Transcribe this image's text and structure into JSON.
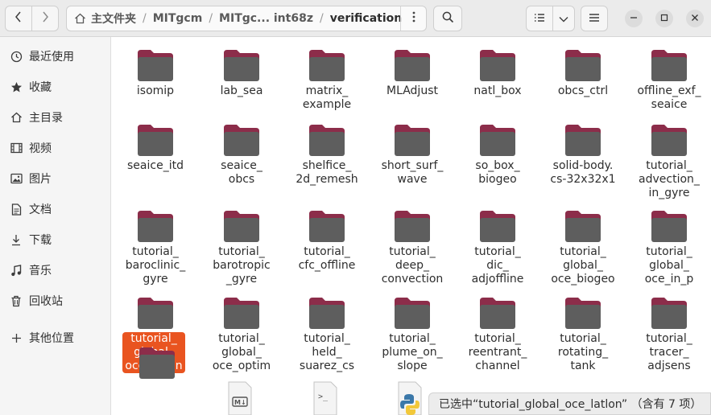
{
  "header": {
    "back_icon": "chevron-left-icon",
    "forward_icon": "chevron-right-icon",
    "breadcrumbs": [
      "主文件夹",
      "MITgcm",
      "MITgc... int68z",
      "verification"
    ],
    "search_icon": "search-icon",
    "view_icon": "list-view-icon",
    "menu_icon": "hamburger-menu-icon"
  },
  "sidebar": {
    "items": [
      {
        "label": "最近使用",
        "icon": "clock-icon"
      },
      {
        "label": "收藏",
        "icon": "star-icon"
      },
      {
        "label": "主目录",
        "icon": "home-icon"
      },
      {
        "label": "视频",
        "icon": "film-icon"
      },
      {
        "label": "图片",
        "icon": "image-icon"
      },
      {
        "label": "文档",
        "icon": "document-icon"
      },
      {
        "label": "下载",
        "icon": "download-icon"
      },
      {
        "label": "音乐",
        "icon": "music-icon"
      },
      {
        "label": "回收站",
        "icon": "trash-icon"
      },
      {
        "label": "其他位置",
        "icon": "plus-icon"
      }
    ]
  },
  "folders": [
    {
      "name": "isomip"
    },
    {
      "name": "lab_sea"
    },
    {
      "name": "matrix_\nexample"
    },
    {
      "name": "MLAdjust"
    },
    {
      "name": "natl_box"
    },
    {
      "name": "obcs_ctrl"
    },
    {
      "name": "offline_exf_\nseaice"
    },
    {
      "name": "seaice_itd"
    },
    {
      "name": "seaice_\nobcs"
    },
    {
      "name": "shelfice_\n2d_remesh"
    },
    {
      "name": "short_surf_\nwave"
    },
    {
      "name": "so_box_\nbiogeo"
    },
    {
      "name": "solid-body.\ncs-32x32x1"
    },
    {
      "name": "tutorial_\nadvection_\nin_gyre"
    },
    {
      "name": "tutorial_\nbaroclinic_\ngyre"
    },
    {
      "name": "tutorial_\nbarotropic\n_gyre"
    },
    {
      "name": "tutorial_\ncfc_offline"
    },
    {
      "name": "tutorial_\ndeep_\nconvection"
    },
    {
      "name": "tutorial_\ndic_\nadjoffline"
    },
    {
      "name": "tutorial_\nglobal_\noce_biogeo"
    },
    {
      "name": "tutorial_\nglobal_\noce_in_p"
    },
    {
      "name": "tutorial_\nglobal_\noce_latlon"
    },
    {
      "name": "tutorial_\nglobal_\noce_optim"
    },
    {
      "name": "tutorial_\nheld_\nsuarez_cs"
    },
    {
      "name": "tutorial_\nplume_on_\nslope"
    },
    {
      "name": "tutorial_\nreentrant_\nchannel"
    },
    {
      "name": "tutorial_\nrotating_\ntank"
    },
    {
      "name": "tutorial_\ntracer_\nadjsens"
    }
  ],
  "bottom_icons": [
    "folder-icon",
    "markdown-file-icon",
    "script-file-icon",
    "python-file-icon"
  ],
  "status": "已选中“tutorial_global_oce_latlon” （含有 7 项）",
  "colors": {
    "accent": "#e95420",
    "folder_body": "#5e5e5e",
    "folder_tab": "#8c2d4a"
  }
}
